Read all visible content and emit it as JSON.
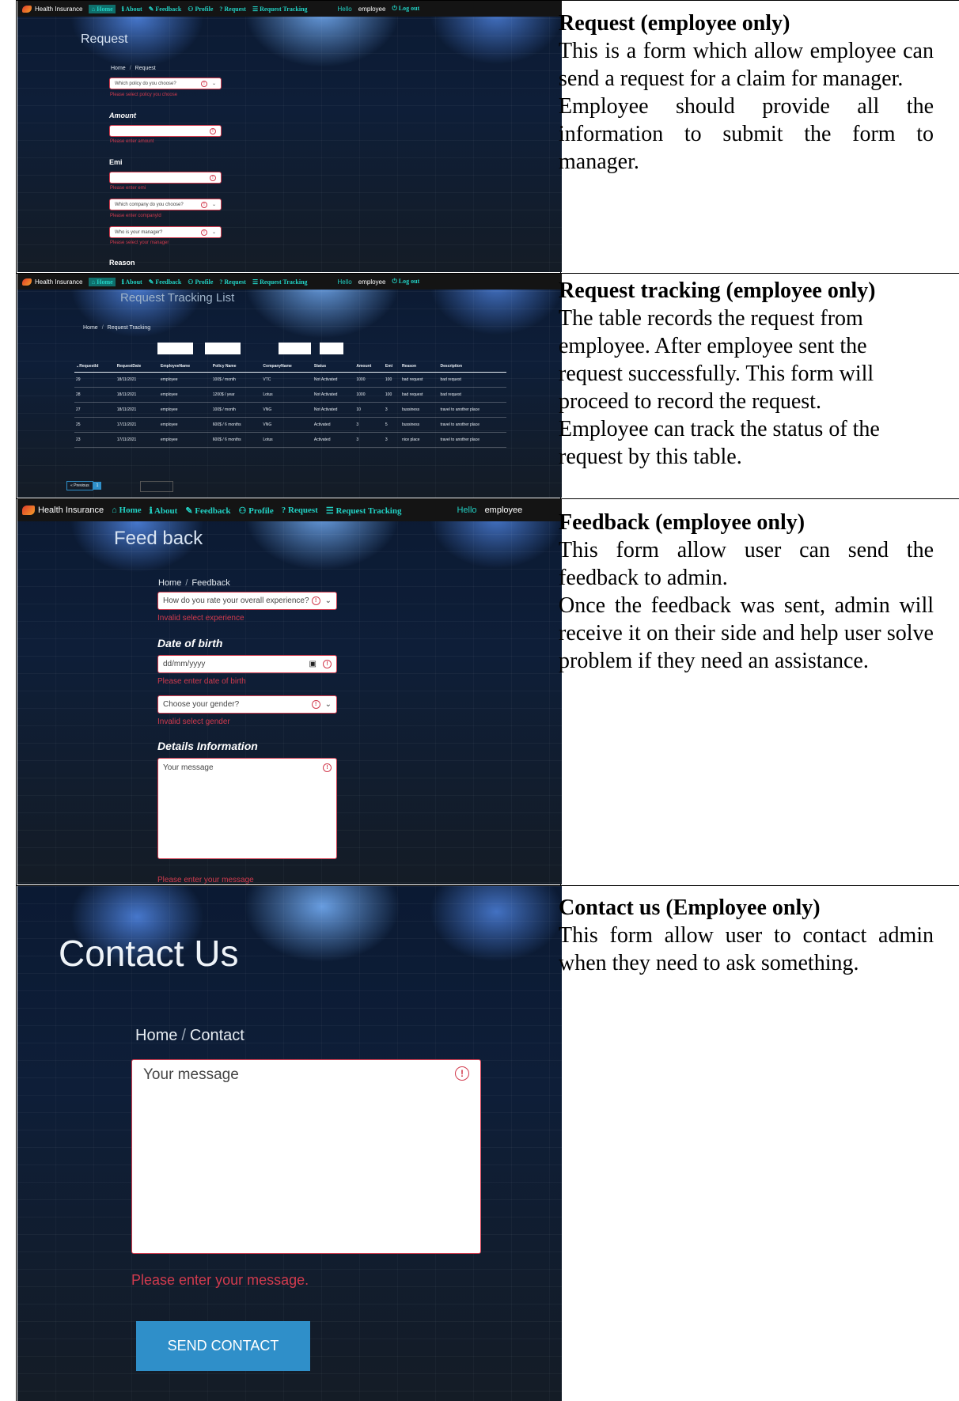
{
  "rows": [
    {
      "title": "Request (employee only)",
      "paragraphs": [
        "This is a form which allow employee can send a request for a claim for manager.",
        "Employee should provide all the information to submit the form to manager."
      ]
    },
    {
      "title": "Request tracking (employee only)",
      "paragraphs": [
        "The table records the request from employee. After employee sent the request successfully. This form will proceed to record the request.",
        "Employee can track the status of the request by this table."
      ]
    },
    {
      "title": "Feedback (employee only)",
      "paragraphs": [
        "This form allow user can send the feedback to admin.",
        "Once the feedback was sent, admin will receive it on their side and help user solve problem if they need an assistance."
      ]
    },
    {
      "title": "Contact us (Employee only)",
      "paragraphs": [
        "This form allow user to contact admin when they need to ask something."
      ]
    }
  ],
  "nav": {
    "brand": "Health Insurance",
    "home": "Home",
    "about": "About",
    "feedback": "Feedback",
    "profile": "Profile",
    "request": "Request",
    "tracking": "Request Tracking",
    "hello": "Hello",
    "user": "employee",
    "logout": "Log out"
  },
  "request_form": {
    "title": "Request",
    "crumb_home": "Home",
    "crumb_current": "Request",
    "policy_placeholder": "Which policy do you choose?",
    "policy_error": "Please select policy you choose",
    "amount_label": "Amount",
    "amount_error": "Please enter amount",
    "emi_label": "Emi",
    "emi_error": "Please enter emi",
    "company_placeholder": "Which company do you choose?",
    "company_error": "Please enter companyId",
    "manager_placeholder": "Who is your manager?",
    "manager_error": "Please select your manager",
    "reason_label": "Reason"
  },
  "tracking": {
    "title": "Request Tracking List",
    "crumb_home": "Home",
    "crumb_current": "Request Tracking",
    "columns": [
      "RequestId",
      "RequestDate",
      "EmployeeName",
      "Policy Name",
      "CompanyName",
      "Status",
      "Amount",
      "Emi",
      "Reason",
      "Description"
    ],
    "rows": [
      [
        "29",
        "18/11/2021",
        "employee",
        "100$ / month",
        "VTC",
        "Not Activated",
        "1000",
        "100",
        "bad request",
        "bad request"
      ],
      [
        "28",
        "18/11/2021",
        "employee",
        "1200$ / year",
        "Lotus",
        "Not Activated",
        "1000",
        "100",
        "bad request",
        "bad request"
      ],
      [
        "27",
        "18/11/2021",
        "employee",
        "100$ / month",
        "VNG",
        "Not Activated",
        "10",
        "3",
        "bussiness",
        "travel to another place"
      ],
      [
        "25",
        "17/11/2021",
        "employee",
        "600$ / 6 months",
        "VNG",
        "Activated",
        "3",
        "5",
        "bussiness",
        "travel to another place"
      ],
      [
        "23",
        "17/11/2021",
        "employee",
        "600$ / 6 months",
        "Lotus",
        "Activated",
        "3",
        "3",
        "nice place",
        "travel to another place"
      ]
    ],
    "previous": "« Previous",
    "page": "1"
  },
  "feedback_form": {
    "title": "Feed back",
    "crumb_home": "Home",
    "crumb_current": "Feedback",
    "experience_placeholder": "How do you rate your overall experience?",
    "experience_error": "Invalid select experience",
    "dob_label": "Date of birth",
    "dob_placeholder": "dd/mm/yyyy",
    "dob_error": "Please enter date of birth",
    "gender_placeholder": "Choose your gender?",
    "gender_error": "Invalid select gender",
    "details_label": "Details Information",
    "message_placeholder": "Your message",
    "message_error": "Please enter your message"
  },
  "contact_form": {
    "title": "Contact Us",
    "crumb_home": "Home",
    "crumb_current": "Contact",
    "message_placeholder": "Your message",
    "message_error": "Please enter your message.",
    "send_label": "SEND CONTACT"
  }
}
